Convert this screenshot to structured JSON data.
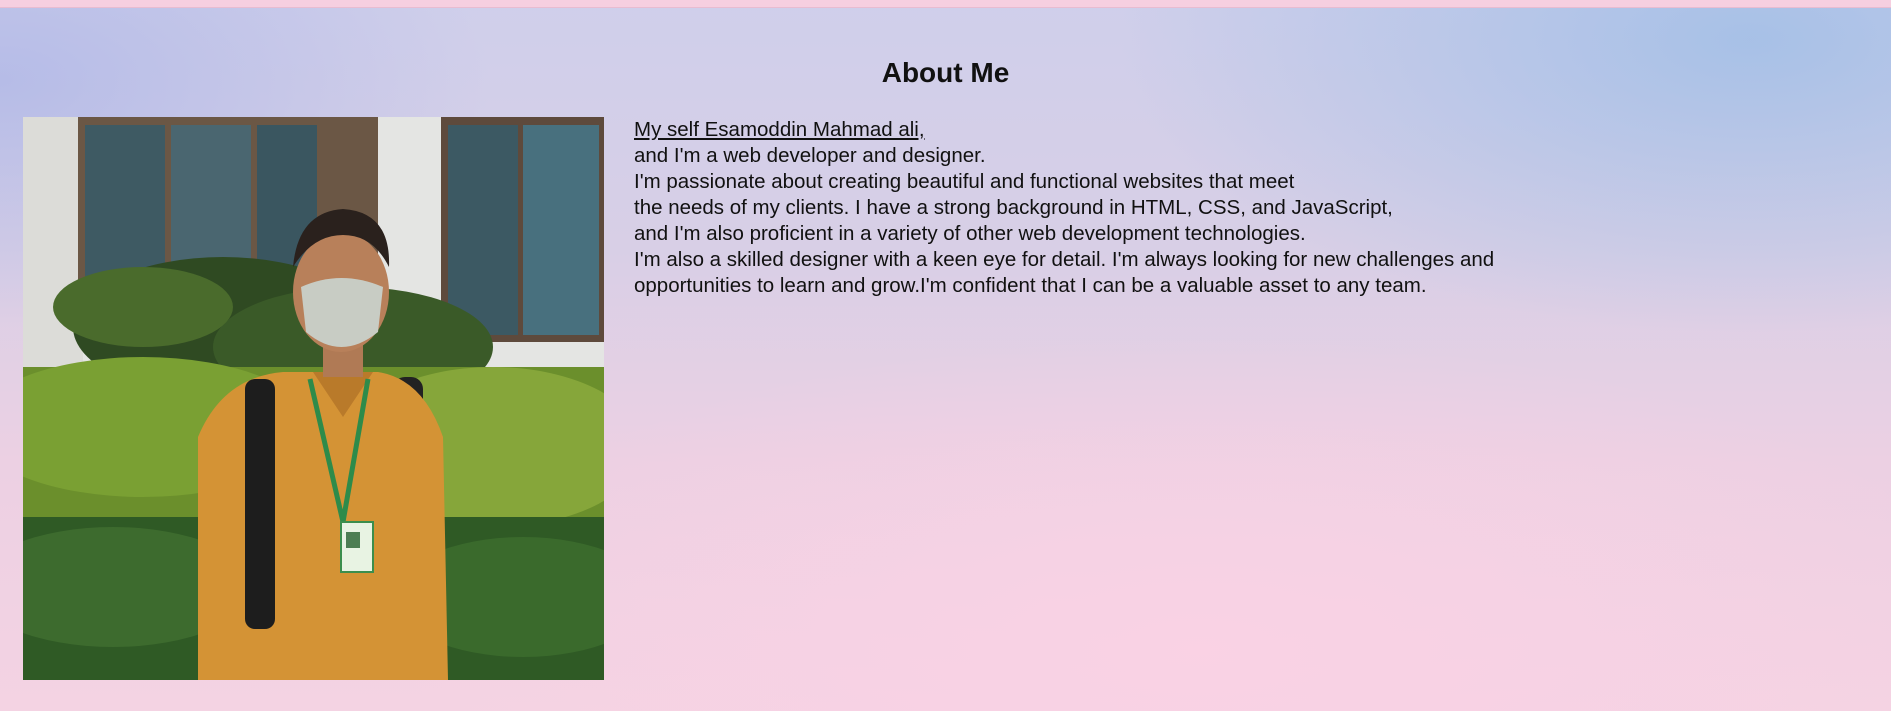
{
  "page": {
    "title": "About Me"
  },
  "photo": {
    "alt": "profile photo",
    "colors": {
      "sky_building": "#e6e6e6",
      "window": "#3f5962",
      "hedge": "#5f8a2a",
      "shirt": "#d99a3a",
      "mask": "#c9cdc6"
    }
  },
  "bio": {
    "name_link": "My self Esamoddin Mahmad ali,",
    "lines": [
      "and I'm a web developer and designer.",
      "I'm passionate about creating beautiful and functional websites that meet",
      "the needs of my clients. I have a strong background in HTML, CSS, and JavaScript,",
      "and I'm also proficient in a variety of other web development technologies.",
      "I'm also a skilled designer with a keen eye for detail. I'm always looking for new challenges and",
      "opportunities to learn and grow.I'm confident that I can be a valuable asset to any team."
    ]
  }
}
